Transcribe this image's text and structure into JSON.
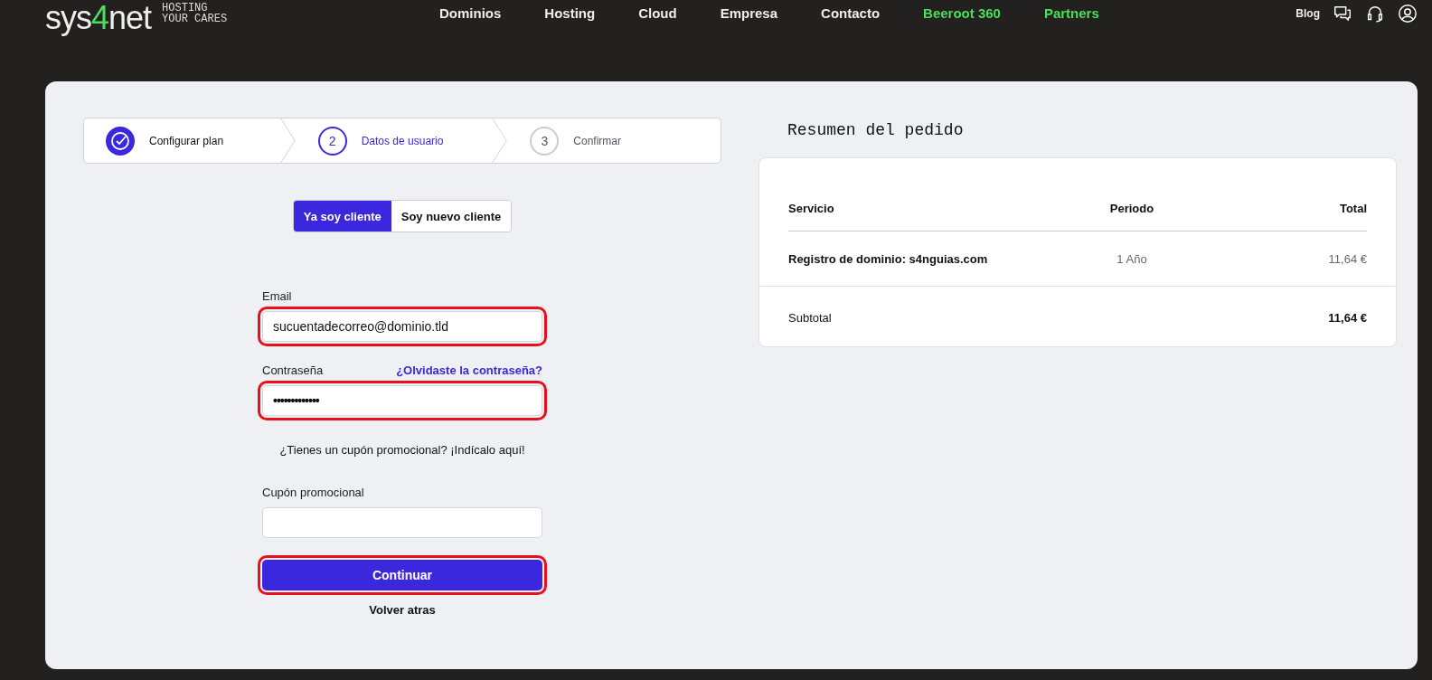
{
  "header": {
    "logo": {
      "before": "sys",
      "accent": "4",
      "after": "net"
    },
    "tagline": [
      "HOSTING",
      "YOUR CARES"
    ],
    "nav": [
      {
        "label": "Dominios",
        "accent": false
      },
      {
        "label": "Hosting",
        "accent": false
      },
      {
        "label": "Cloud",
        "accent": false
      },
      {
        "label": "Empresa",
        "accent": false
      },
      {
        "label": "Contacto",
        "accent": false
      },
      {
        "label": "Beeroot 360",
        "accent": true
      },
      {
        "label": "Partners",
        "accent": true
      }
    ],
    "blog": "Blog"
  },
  "steps": [
    {
      "label": "Configurar plan",
      "done": true,
      "current": false
    },
    {
      "number": "2",
      "label": "Datos de usuario",
      "done": false,
      "current": true
    },
    {
      "number": "3",
      "label": "Confirmar",
      "done": false,
      "current": false
    }
  ],
  "toggle": [
    {
      "label": "Ya soy cliente",
      "selected": true
    },
    {
      "label": "Soy nuevo cliente",
      "selected": false
    }
  ],
  "form": {
    "email": {
      "label": "Email",
      "value": "sucuentadecorreo@dominio.tld",
      "highlighted": true
    },
    "password": {
      "label": "Contraseña",
      "link": "¿Olvidaste la contraseña?",
      "value": "•••••••••••••",
      "highlighted": true
    },
    "coupon_prompt": "¿Tienes un cupón promocional? ¡Indícalo aquí!",
    "coupon": {
      "label": "Cupón promocional",
      "highlighted": false
    },
    "submit": {
      "label": "Continuar",
      "highlighted": true
    },
    "back": "Volver atras"
  },
  "summary": {
    "title": "Resumen del pedido",
    "columns": [
      "Servicio",
      "Periodo",
      "Total"
    ],
    "rows": [
      {
        "service": "Registro de dominio: s4nguias.com",
        "period": "1 Año",
        "total": "11,64 €"
      }
    ],
    "subtotal_label": "Subtotal",
    "subtotal": "11,64 €"
  }
}
